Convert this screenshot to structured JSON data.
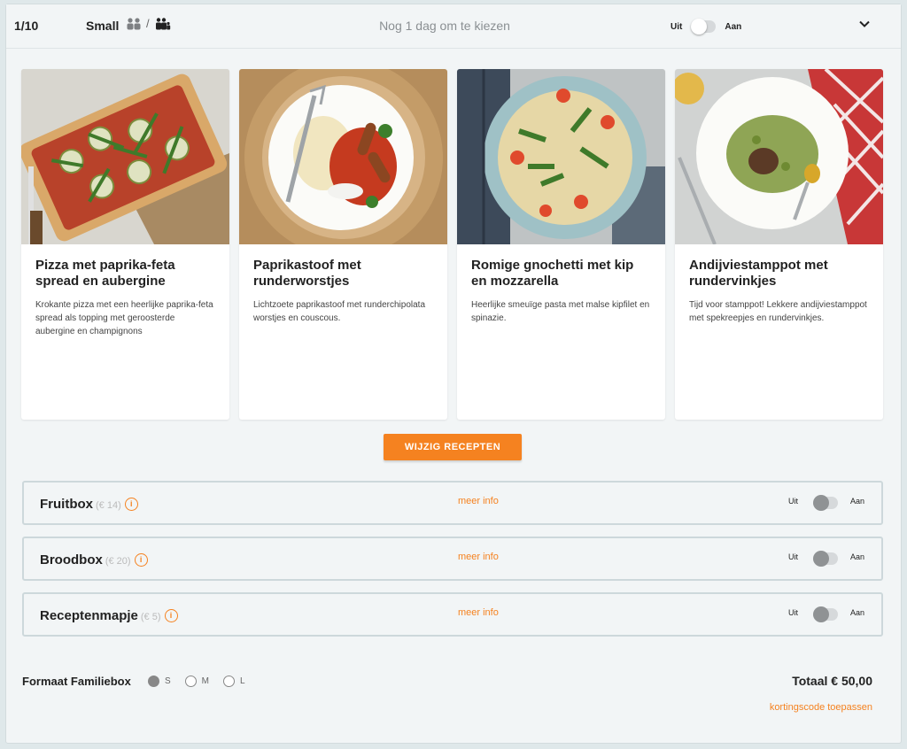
{
  "header": {
    "count": "1/10",
    "size": "Small",
    "deadline": "Nog 1 dag om te kiezen",
    "toggle_off": "Uit",
    "toggle_on": "Aan"
  },
  "recipes": [
    {
      "title": "Pizza met paprika-feta spread en aubergine",
      "desc": "Krokante pizza met een heerlijke paprika-feta spread als topping met geroosterde aubergine en champignons"
    },
    {
      "title": "Paprikastoof met runderworstjes",
      "desc": "Lichtzoete paprikastoof met runderchipolata worstjes en couscous."
    },
    {
      "title": "Romige gnochetti met kip en mozzarella",
      "desc": "Heerlijke smeuïge pasta met malse kipfilet en spinazie."
    },
    {
      "title": "Andijviestamppot met rundervinkjes",
      "desc": "Tijd voor stamppot! Lekkere andijviestamppot met spekreepjes en rundervinkjes."
    }
  ],
  "change_button": "WIJZIG RECEPTEN",
  "extras": [
    {
      "name": "Fruitbox",
      "price": "(€ 14)",
      "more": "meer info",
      "off": "Uit",
      "on": "Aan"
    },
    {
      "name": "Broodbox",
      "price": "(€ 20)",
      "more": "meer info",
      "off": "Uit",
      "on": "Aan"
    },
    {
      "name": "Receptenmapje",
      "price": "(€ 5)",
      "more": "meer info",
      "off": "Uit",
      "on": "Aan"
    }
  ],
  "footer": {
    "format_label": "Formaat Familiebox",
    "sizes": [
      "S",
      "M",
      "L"
    ],
    "selected_size": "S",
    "total": "Totaal € 50,00",
    "discount": "kortingscode toepassen"
  },
  "colors": {
    "accent": "#f58220",
    "panel": "#f2f5f6"
  }
}
